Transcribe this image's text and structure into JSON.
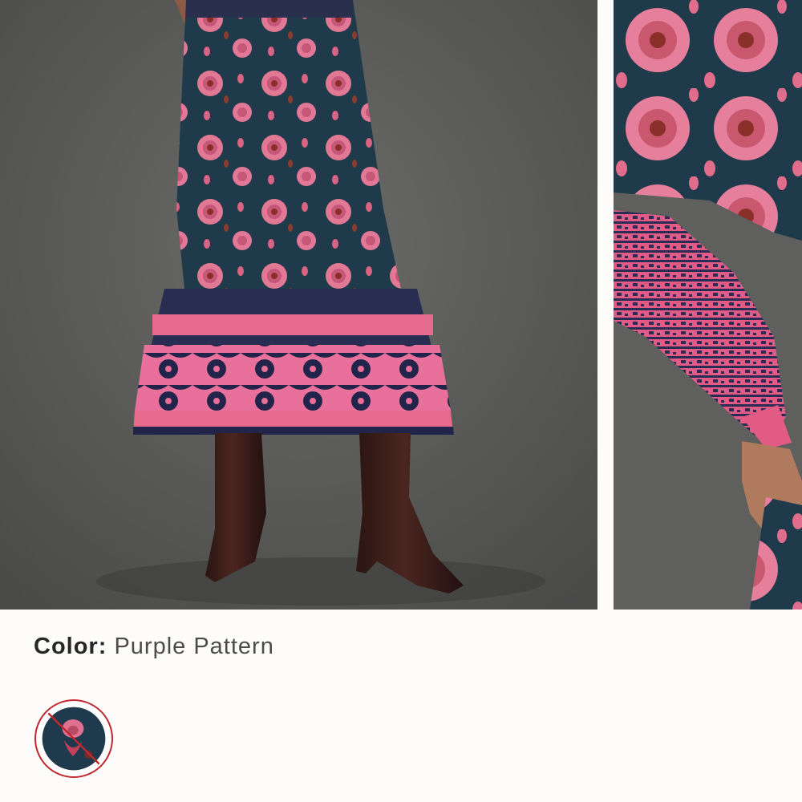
{
  "product": {
    "color_label": "Color:",
    "color_value": "Purple Pattern"
  },
  "gallery": {
    "images": [
      {
        "name": "model-skirt-boots-photo"
      },
      {
        "name": "sleeve-detail-photo"
      }
    ]
  },
  "swatches": [
    {
      "name": "Purple Pattern",
      "selected": true,
      "unavailable": true
    }
  ],
  "colors": {
    "background": "#fdfcfa",
    "photo_backdrop": "#5c5c5a",
    "fabric_navy": "#1f3a4a",
    "fabric_pink": "#e66a8c",
    "unavailable_slash": "#c1272d"
  }
}
